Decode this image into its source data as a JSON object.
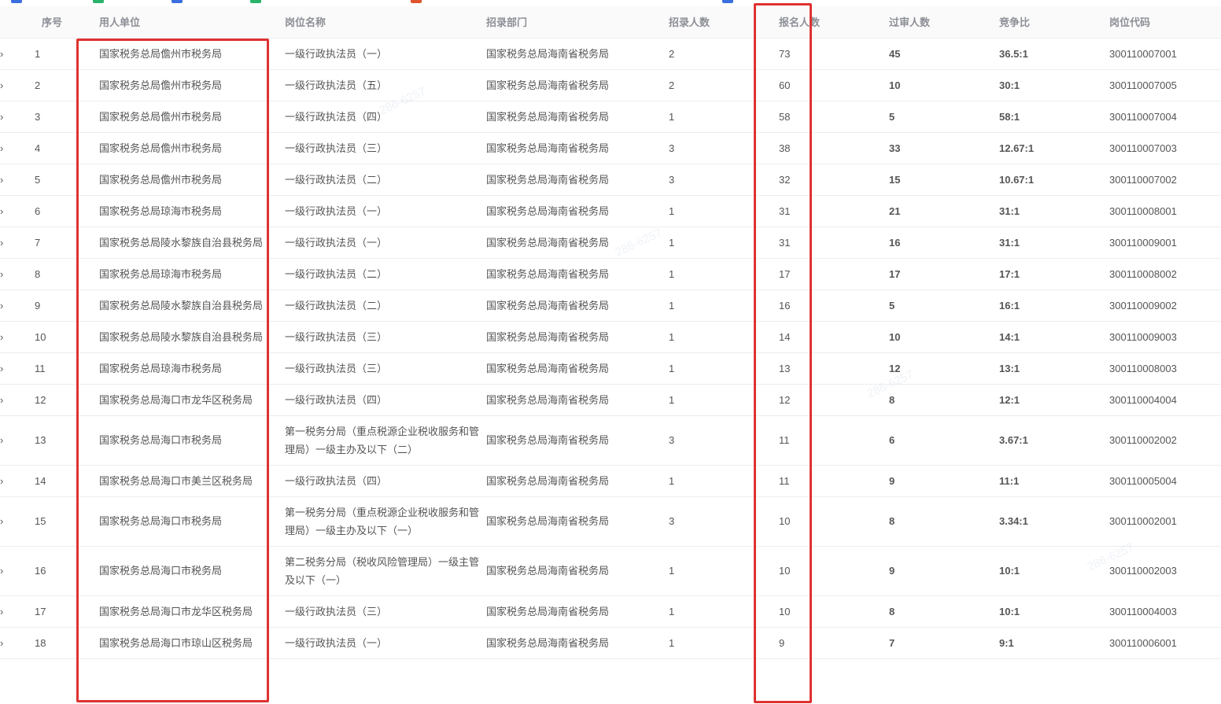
{
  "table": {
    "headers": {
      "no": "序号",
      "unit": "用人单位",
      "post": "岗位名称",
      "dept": "招录部门",
      "recruit": "招录人数",
      "apply": "报名人数",
      "passed": "过审人数",
      "ratio": "竞争比",
      "code": "岗位代码"
    },
    "expand_icon": "chevron-right-icon",
    "rows": [
      {
        "no": "1",
        "unit": "国家税务总局儋州市税务局",
        "post": "一级行政执法员（一）",
        "dept": "国家税务总局海南省税务局",
        "recruit": "2",
        "apply": "73",
        "passed": "45",
        "ratio": "36.5:1",
        "code": "300110007001"
      },
      {
        "no": "2",
        "unit": "国家税务总局儋州市税务局",
        "post": "一级行政执法员（五）",
        "dept": "国家税务总局海南省税务局",
        "recruit": "2",
        "apply": "60",
        "passed": "10",
        "ratio": "30:1",
        "code": "300110007005"
      },
      {
        "no": "3",
        "unit": "国家税务总局儋州市税务局",
        "post": "一级行政执法员（四）",
        "dept": "国家税务总局海南省税务局",
        "recruit": "1",
        "apply": "58",
        "passed": "5",
        "ratio": "58:1",
        "code": "300110007004"
      },
      {
        "no": "4",
        "unit": "国家税务总局儋州市税务局",
        "post": "一级行政执法员（三）",
        "dept": "国家税务总局海南省税务局",
        "recruit": "3",
        "apply": "38",
        "passed": "33",
        "ratio": "12.67:1",
        "code": "300110007003"
      },
      {
        "no": "5",
        "unit": "国家税务总局儋州市税务局",
        "post": "一级行政执法员（二）",
        "dept": "国家税务总局海南省税务局",
        "recruit": "3",
        "apply": "32",
        "passed": "15",
        "ratio": "10.67:1",
        "code": "300110007002"
      },
      {
        "no": "6",
        "unit": "国家税务总局琼海市税务局",
        "post": "一级行政执法员（一）",
        "dept": "国家税务总局海南省税务局",
        "recruit": "1",
        "apply": "31",
        "passed": "21",
        "ratio": "31:1",
        "code": "300110008001"
      },
      {
        "no": "7",
        "unit": "国家税务总局陵水黎族自治县税务局",
        "post": "一级行政执法员（一）",
        "dept": "国家税务总局海南省税务局",
        "recruit": "1",
        "apply": "31",
        "passed": "16",
        "ratio": "31:1",
        "code": "300110009001"
      },
      {
        "no": "8",
        "unit": "国家税务总局琼海市税务局",
        "post": "一级行政执法员（二）",
        "dept": "国家税务总局海南省税务局",
        "recruit": "1",
        "apply": "17",
        "passed": "17",
        "ratio": "17:1",
        "code": "300110008002"
      },
      {
        "no": "9",
        "unit": "国家税务总局陵水黎族自治县税务局",
        "post": "一级行政执法员（二）",
        "dept": "国家税务总局海南省税务局",
        "recruit": "1",
        "apply": "16",
        "passed": "5",
        "ratio": "16:1",
        "code": "300110009002"
      },
      {
        "no": "10",
        "unit": "国家税务总局陵水黎族自治县税务局",
        "post": "一级行政执法员（三）",
        "dept": "国家税务总局海南省税务局",
        "recruit": "1",
        "apply": "14",
        "passed": "10",
        "ratio": "14:1",
        "code": "300110009003"
      },
      {
        "no": "11",
        "unit": "国家税务总局琼海市税务局",
        "post": "一级行政执法员（三）",
        "dept": "国家税务总局海南省税务局",
        "recruit": "1",
        "apply": "13",
        "passed": "12",
        "ratio": "13:1",
        "code": "300110008003"
      },
      {
        "no": "12",
        "unit": "国家税务总局海口市龙华区税务局",
        "post": "一级行政执法员（四）",
        "dept": "国家税务总局海南省税务局",
        "recruit": "1",
        "apply": "12",
        "passed": "8",
        "ratio": "12:1",
        "code": "300110004004"
      },
      {
        "no": "13",
        "unit": "国家税务总局海口市税务局",
        "post": "第一税务分局（重点税源企业税收服务和管理局）一级主办及以下（二）",
        "dept": "国家税务总局海南省税务局",
        "recruit": "3",
        "apply": "11",
        "passed": "6",
        "ratio": "3.67:1",
        "code": "300110002002"
      },
      {
        "no": "14",
        "unit": "国家税务总局海口市美兰区税务局",
        "post": "一级行政执法员（四）",
        "dept": "国家税务总局海南省税务局",
        "recruit": "1",
        "apply": "11",
        "passed": "9",
        "ratio": "11:1",
        "code": "300110005004"
      },
      {
        "no": "15",
        "unit": "国家税务总局海口市税务局",
        "post": "第一税务分局（重点税源企业税收服务和管理局）一级主办及以下（一）",
        "dept": "国家税务总局海南省税务局",
        "recruit": "3",
        "apply": "10",
        "passed": "8",
        "ratio": "3.34:1",
        "code": "300110002001"
      },
      {
        "no": "16",
        "unit": "国家税务总局海口市税务局",
        "post": "第二税务分局（税收风险管理局）一级主管及以下（一）",
        "dept": "国家税务总局海南省税务局",
        "recruit": "1",
        "apply": "10",
        "passed": "9",
        "ratio": "10:1",
        "code": "300110002003"
      },
      {
        "no": "17",
        "unit": "国家税务总局海口市龙华区税务局",
        "post": "一级行政执法员（三）",
        "dept": "国家税务总局海南省税务局",
        "recruit": "1",
        "apply": "10",
        "passed": "8",
        "ratio": "10:1",
        "code": "300110004003"
      },
      {
        "no": "18",
        "unit": "国家税务总局海口市琼山区税务局",
        "post": "一级行政执法员（一）",
        "dept": "国家税务总局海南省税务局",
        "recruit": "1",
        "apply": "9",
        "passed": "7",
        "ratio": "9:1",
        "code": "300110006001"
      }
    ]
  },
  "colors": {
    "highlight_box": "#e03131",
    "apply_text": "#4a8af4",
    "passed_text": "#1f9e6a",
    "ratio_text": "#e08b2b"
  }
}
